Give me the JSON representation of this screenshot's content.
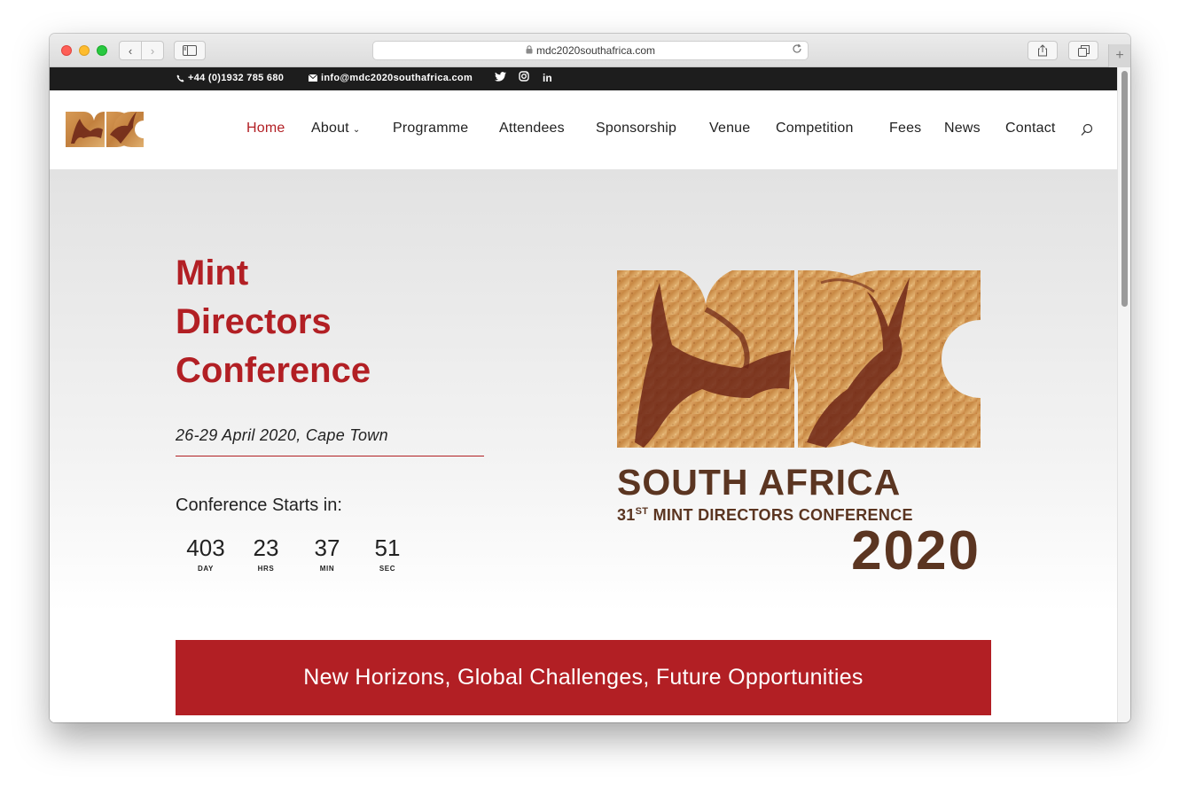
{
  "browser": {
    "url": "mdc2020southafrica.com",
    "back_glyph": "‹",
    "forward_glyph": "›",
    "plus_glyph": "+"
  },
  "topbar": {
    "phone": "+44 (0)1932 785 680",
    "email": "info@mdc2020southafrica.com",
    "social_icons": [
      "twitter-icon",
      "instagram-icon",
      "linkedin-icon"
    ],
    "linkedin_label": "in"
  },
  "nav": {
    "items": [
      {
        "label": "Home",
        "active": true
      },
      {
        "label": "About",
        "dropdown": true
      },
      {
        "label": "Programme"
      },
      {
        "label": "Attendees"
      },
      {
        "label": "Sponsorship"
      },
      {
        "label": "Venue"
      },
      {
        "label": "Competition"
      },
      {
        "label": "Fees"
      },
      {
        "label": "News"
      },
      {
        "label": "Contact"
      }
    ],
    "chevron": "⌄"
  },
  "hero": {
    "title_lines": [
      "Mint",
      "Directors",
      "Conference"
    ],
    "date": "26-29 April 2020, Cape Town",
    "countdown_label": "Conference Starts in:",
    "countdown": [
      {
        "value": "403",
        "unit": "DAY"
      },
      {
        "value": "23",
        "unit": "HRS"
      },
      {
        "value": "37",
        "unit": "MIN"
      },
      {
        "value": "51",
        "unit": "SEC"
      }
    ]
  },
  "brand": {
    "line1": "SOUTH AFRICA",
    "ordinal_number": "31",
    "ordinal_suffix": "ST",
    "line2": " MINT DIRECTORS CONFERENCE",
    "year": "2020"
  },
  "banner": {
    "text": "New Horizons, Global Challenges, Future Opportunities"
  },
  "colors": {
    "accent": "#b21f24",
    "brand_brown": "#5b3521",
    "topbar_bg": "#1d1d1d"
  }
}
